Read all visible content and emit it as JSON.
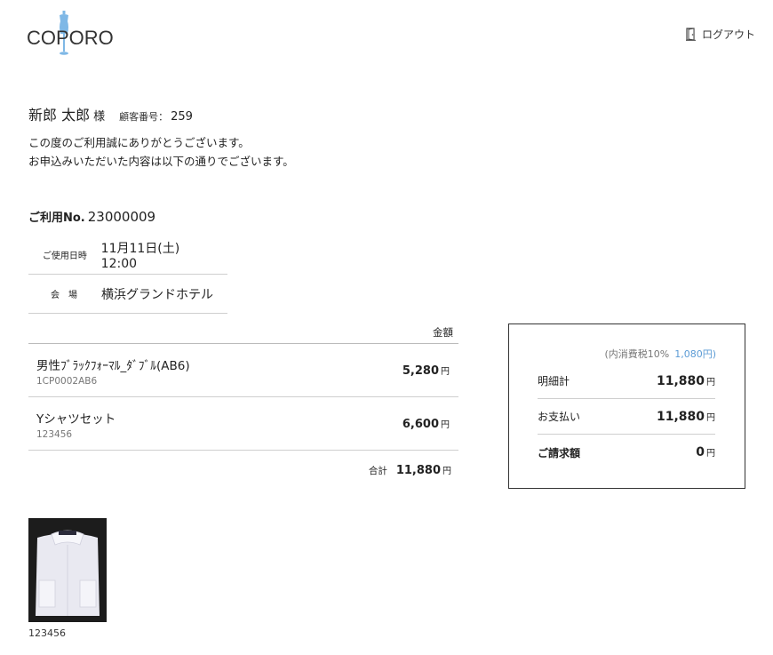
{
  "header": {
    "logo_text": "COPORO",
    "logout_label": "ログアウト"
  },
  "customer": {
    "name": "新郎 太郎",
    "honorific": "様",
    "number_label": "顧客番号：",
    "number": "259"
  },
  "greeting": {
    "line1": "この度のご利用誠にありがとうございます。",
    "line2": "お申込みいただいた内容は以下の通りでございます。"
  },
  "usage": {
    "label": "ご利用No.",
    "number": "23000009",
    "rows": [
      {
        "key": "ご使用日時",
        "value": "11月11日(土)　12:00"
      },
      {
        "key": "会場",
        "value": "横浜グランドホテル"
      }
    ]
  },
  "items": {
    "amount_header": "金額",
    "rows": [
      {
        "name": "男性ﾌﾞﾗｯｸﾌｫｰﾏﾙ_ﾀﾞﾌﾞﾙ(AB6)",
        "code": "1CP0002AB6",
        "price": "5,280",
        "yen": "円"
      },
      {
        "name": "Yシャツセット",
        "code": "123456",
        "price": "6,600",
        "yen": "円"
      }
    ],
    "total_label": "合計",
    "total": "11,880",
    "total_yen": "円"
  },
  "summary": {
    "tax_note": "(内消費税10%",
    "tax_value": "1,080円)",
    "rows": [
      {
        "label": "明細計",
        "amount": "11,880",
        "yen": "円"
      },
      {
        "label": "お支払い",
        "amount": "11,880",
        "yen": "円"
      },
      {
        "label": "ご請求額",
        "amount": "0",
        "yen": "円"
      }
    ]
  },
  "photo": {
    "caption": "123456"
  },
  "colors": {
    "accent": "#5b9bd5",
    "logo_mark": "#7fb8e6"
  }
}
